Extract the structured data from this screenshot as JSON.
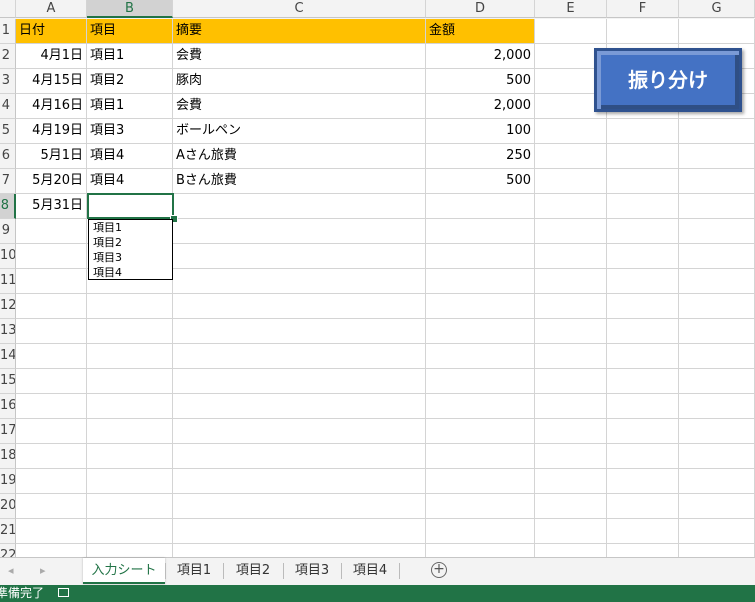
{
  "columns": [
    "A",
    "B",
    "C",
    "D",
    "E",
    "F",
    "G"
  ],
  "rows": [
    "1",
    "2",
    "3",
    "4",
    "5",
    "6",
    "7",
    "8",
    "9",
    "10",
    "11",
    "12",
    "13",
    "14",
    "15",
    "16",
    "17",
    "18",
    "19",
    "20",
    "21",
    "22"
  ],
  "header_row": {
    "a": "日付",
    "b": "項目",
    "c": "摘要",
    "d": "金額"
  },
  "data_rows": [
    {
      "date": "4月1日",
      "item": "項目1",
      "desc": "会費",
      "amount": "2,000"
    },
    {
      "date": "4月15日",
      "item": "項目2",
      "desc": "豚肉",
      "amount": "500"
    },
    {
      "date": "4月16日",
      "item": "項目1",
      "desc": "会費",
      "amount": "2,000"
    },
    {
      "date": "4月19日",
      "item": "項目3",
      "desc": "ボールペン",
      "amount": "100"
    },
    {
      "date": "5月1日",
      "item": "項目4",
      "desc": "Aさん旅費",
      "amount": "250"
    },
    {
      "date": "5月20日",
      "item": "項目4",
      "desc": "Bさん旅費",
      "amount": "500"
    }
  ],
  "active_row": {
    "date": "5月31日",
    "item": "",
    "desc": "",
    "amount": ""
  },
  "dropdown_options": [
    "項目1",
    "項目2",
    "項目3",
    "項目4"
  ],
  "macro_button_label": "振り分け",
  "sheet_tabs": [
    "入力シート",
    "項目1",
    "項目2",
    "項目3",
    "項目4"
  ],
  "status_text": "準備完了",
  "colors": {
    "header_fill": "#ffc000",
    "accent": "#217346",
    "button": "#4472c4"
  }
}
